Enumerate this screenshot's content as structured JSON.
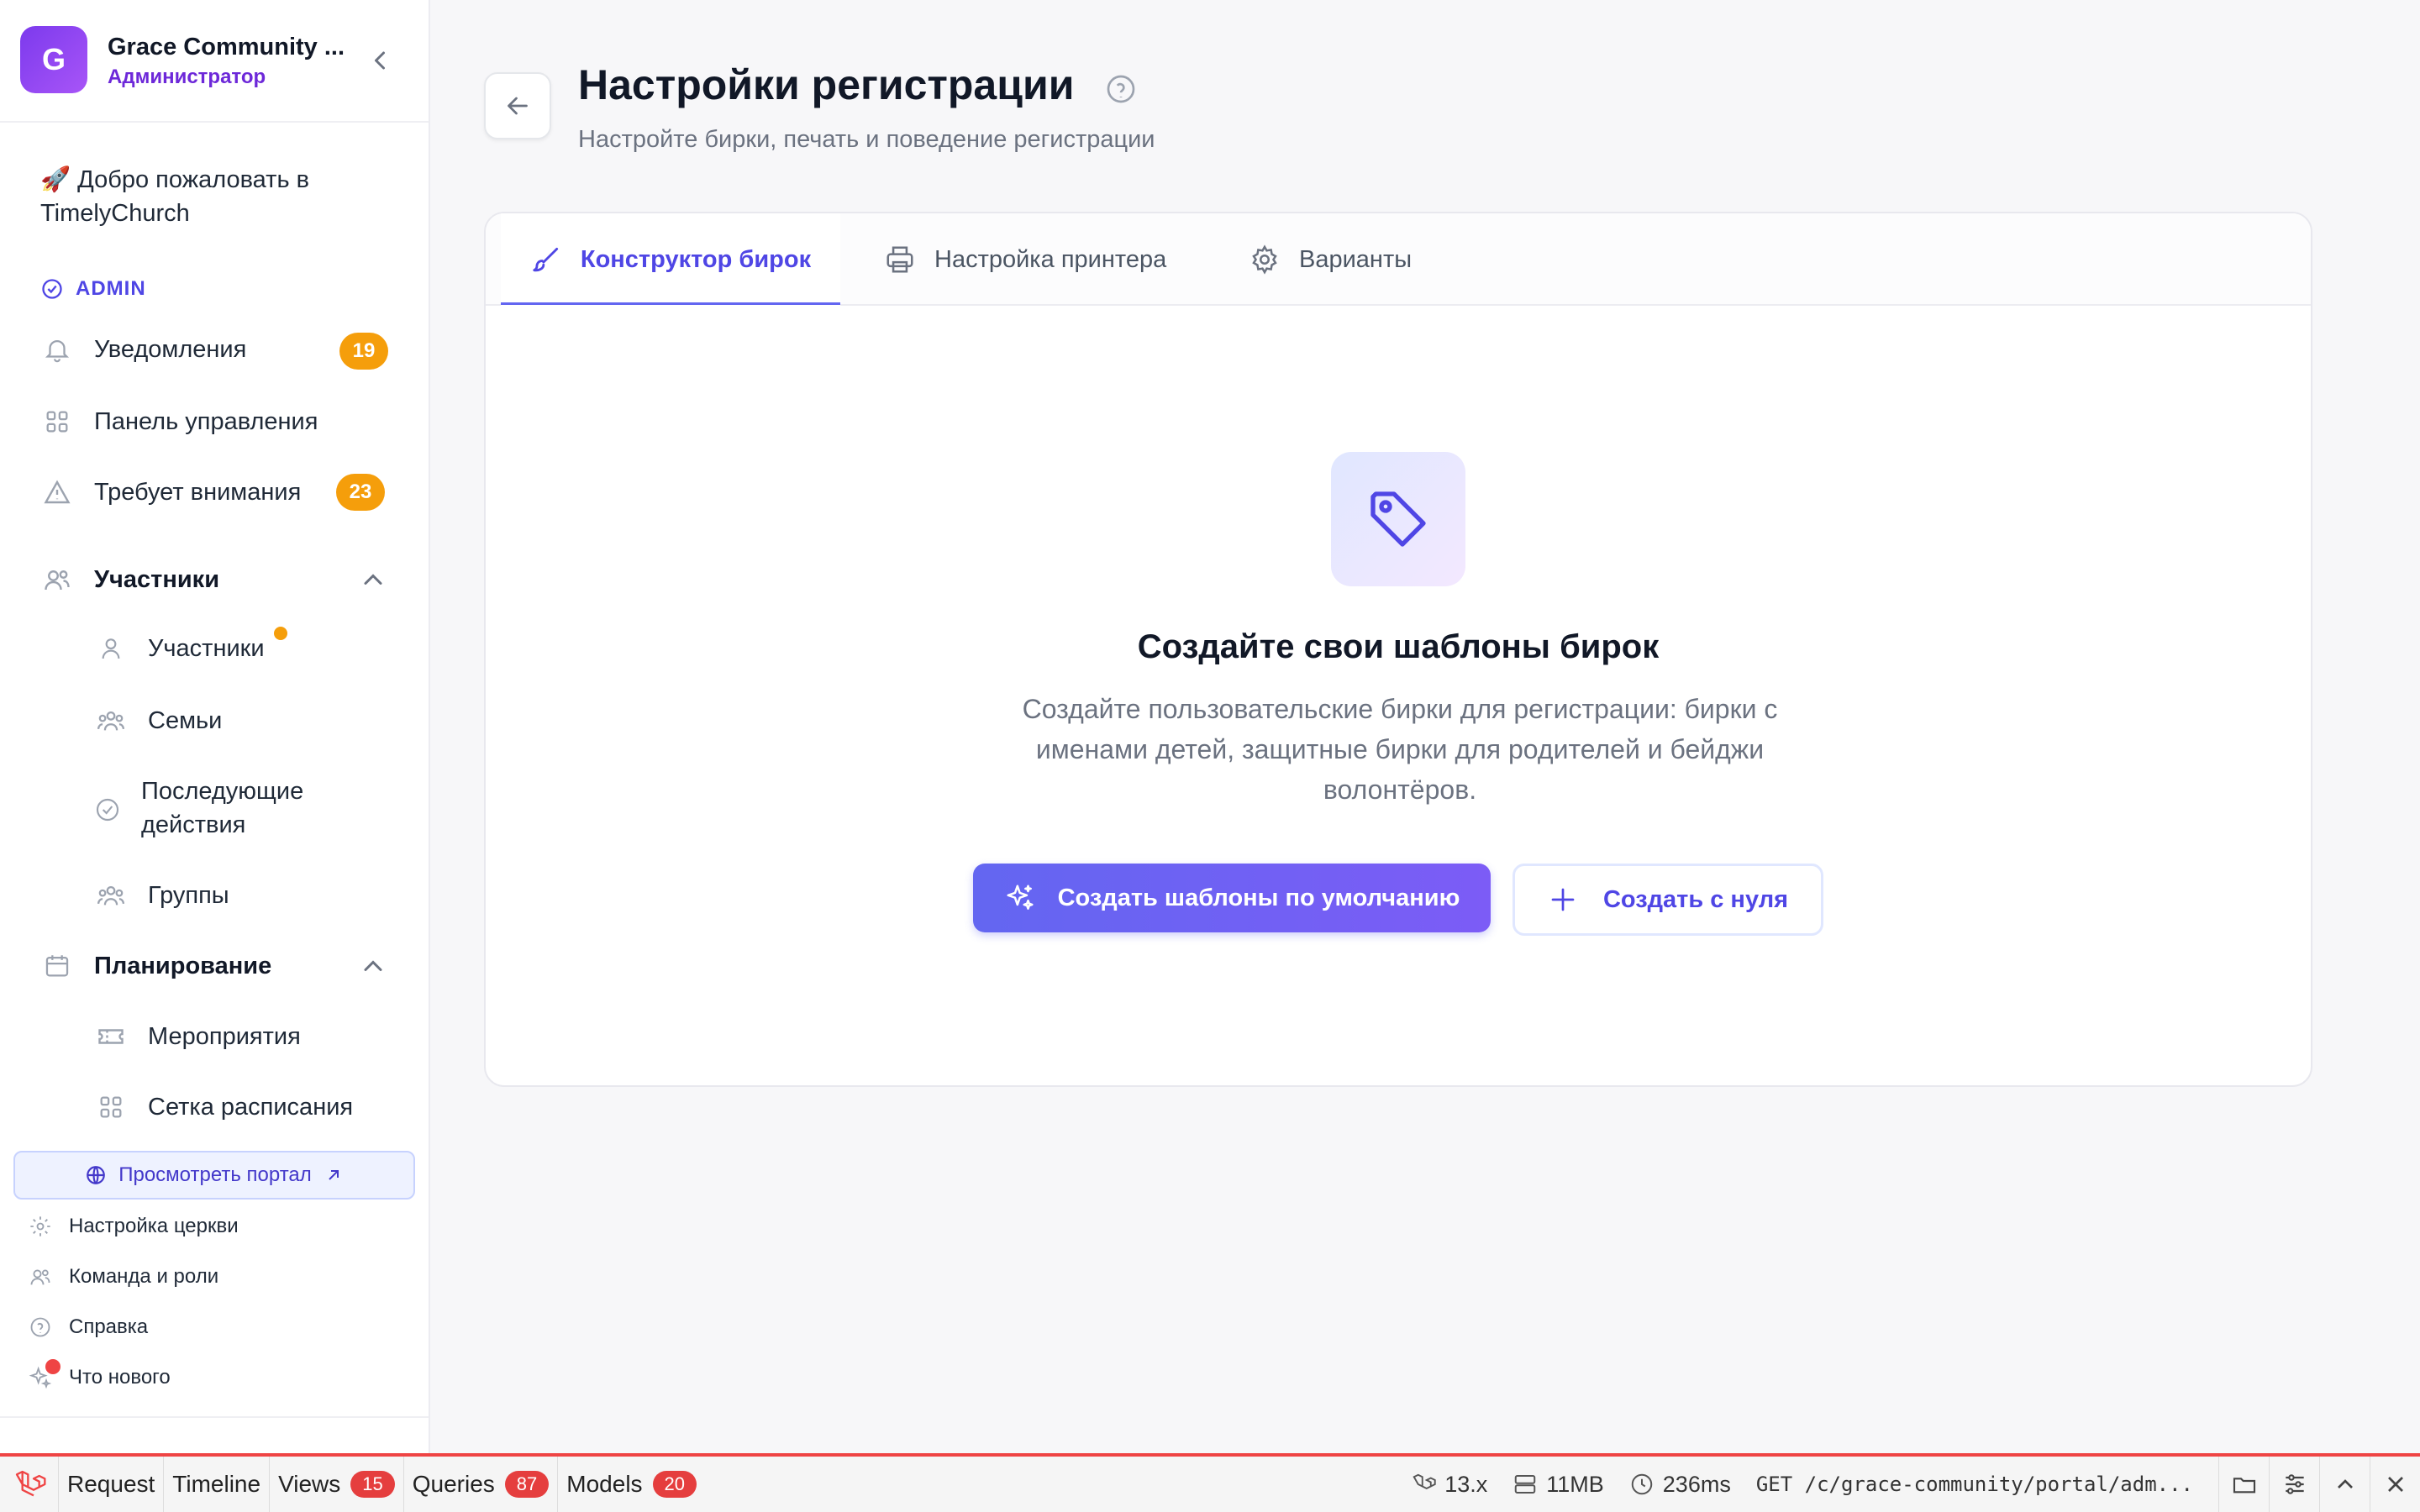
{
  "brand": {
    "initial": "G",
    "name": "Grace Community ...",
    "role": "Администратор"
  },
  "sidebar": {
    "welcome": "🚀 Добро пожаловать в TimelyChurch",
    "admin_label": "ADMIN",
    "notifications": {
      "label": "Уведомления",
      "badge": "19"
    },
    "dashboard": {
      "label": "Панель управления"
    },
    "attention": {
      "label": "Требует внимания",
      "badge": "23"
    },
    "participants_group": {
      "label": "Участники"
    },
    "participants_items": [
      "Участники",
      "Семьи",
      "Последующие действия",
      "Группы"
    ],
    "planning_group": {
      "label": "Планирование"
    },
    "planning_items": [
      "Мероприятия",
      "Сетка расписания"
    ],
    "view_portal": "Просмотреть портал",
    "footer": [
      "Настройка церкви",
      "Команда и роли",
      "Справка",
      "Что нового"
    ]
  },
  "header": {
    "title": "Настройки регистрации",
    "subtitle": "Настройте бирки, печать и поведение регистрации"
  },
  "tabs": [
    {
      "label": "Конструктор бирок",
      "active": true
    },
    {
      "label": "Настройка принтера",
      "active": false
    },
    {
      "label": "Варианты",
      "active": false
    }
  ],
  "empty_state": {
    "title": "Создайте свои шаблоны бирок",
    "description": "Создайте пользовательские бирки для регистрации: бирки с именами детей, защитные бирки для родителей и бейджи волонтёров.",
    "primary_button": "Создать шаблоны по умолчанию",
    "secondary_button": "Создать с нуля"
  },
  "debugbar": {
    "tabs": [
      {
        "label": "Request"
      },
      {
        "label": "Timeline"
      },
      {
        "label": "Views",
        "badge": "15"
      },
      {
        "label": "Queries",
        "badge": "87"
      },
      {
        "label": "Models",
        "badge": "20"
      }
    ],
    "version": "13.x",
    "memory": "11MB",
    "time": "236ms",
    "request": "GET /c/grace-community/portal/adm..."
  },
  "colors": {
    "accent": "#6366f1",
    "badge": "#f59e0b",
    "debug_red": "#ef4444"
  }
}
